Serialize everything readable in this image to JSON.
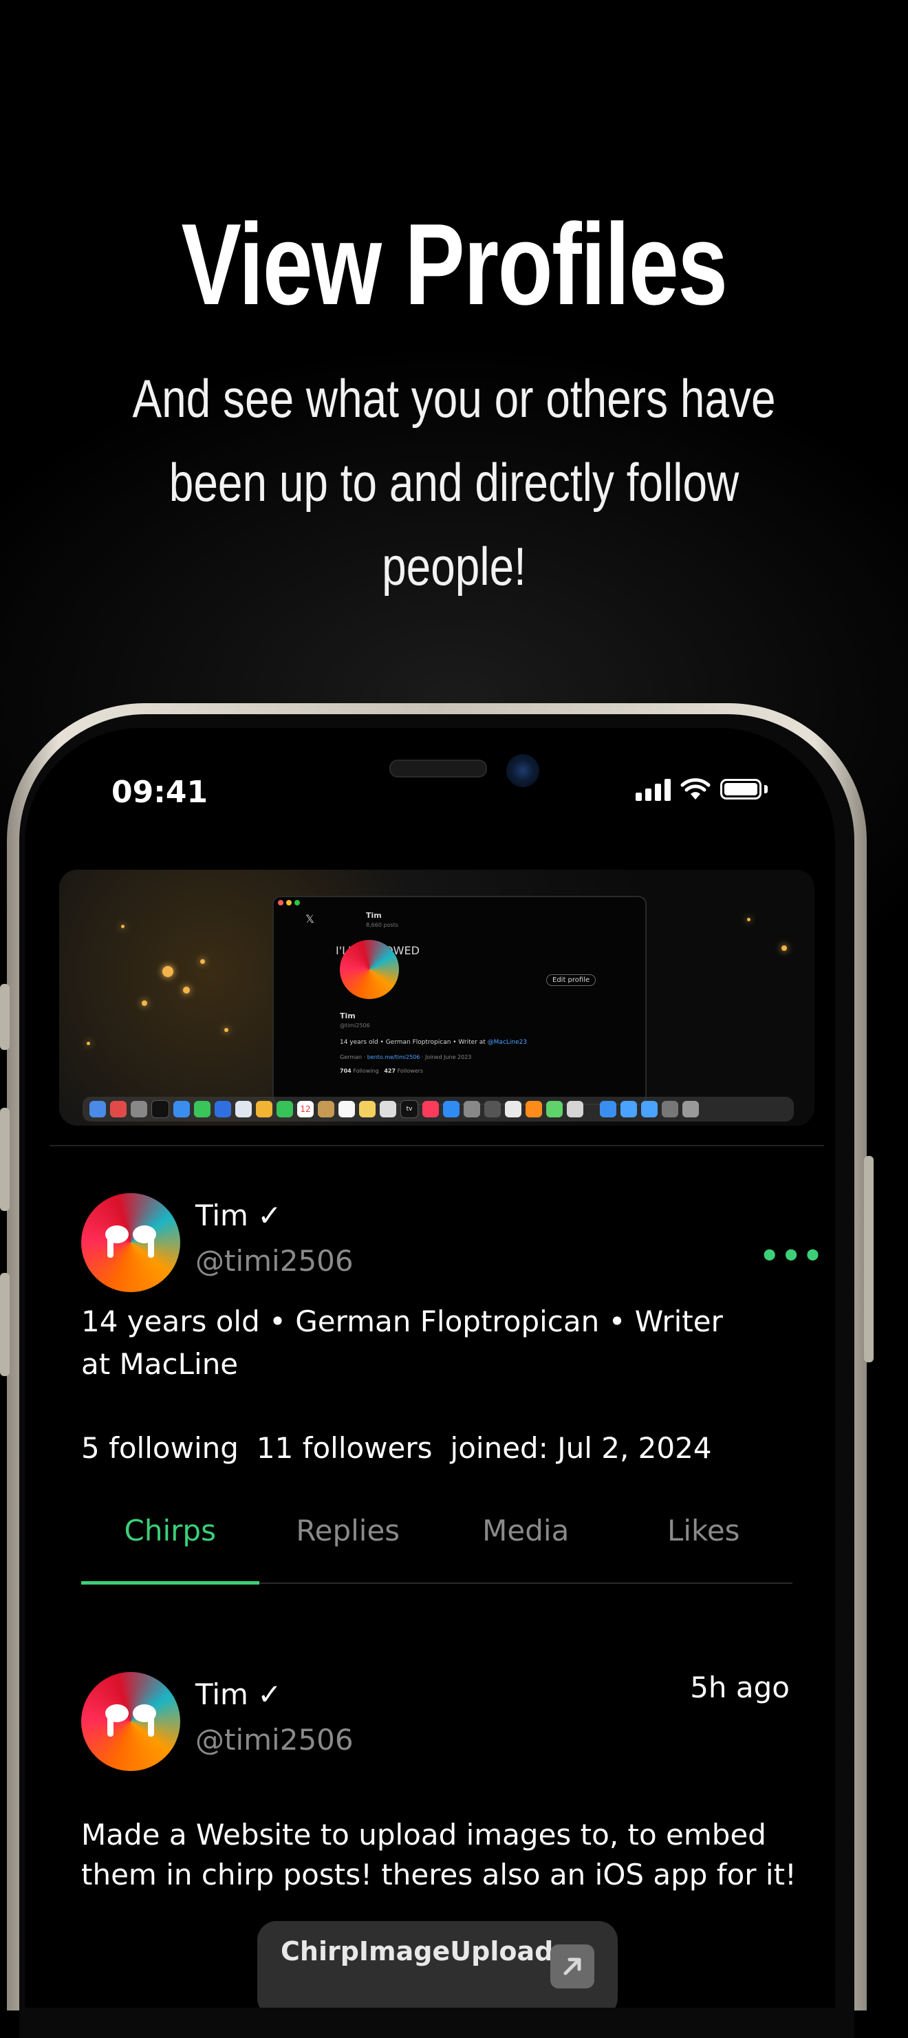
{
  "promo": {
    "title": "View Profiles",
    "subtitle": "And see what you or others have been up to and directly follow people!"
  },
  "status_bar": {
    "time": "09:41"
  },
  "banner_screenshot": {
    "window_name": "Tim",
    "window_posts": "8,660 posts",
    "overlay_text": "I'LL FOLLOWED",
    "edit_profile": "Edit profile",
    "mini_name": "Tim",
    "mini_handle": "@timi2506",
    "mini_bio_prefix": "14 years old • German Floptropican • Writer at ",
    "mini_bio_link": "@MacLine23",
    "mini_meta_location": "German",
    "mini_meta_link": "bento.me/timi2506",
    "mini_meta_joined": "Joined June 2023",
    "mini_following_count": "704",
    "mini_following_label": "Following",
    "mini_followers_count": "427",
    "mini_followers_label": "Followers",
    "dock_calendar_day": "12",
    "dock_tv_label": "tv"
  },
  "profile": {
    "name": "Tim ✓",
    "handle": "@timi2506",
    "more_label": "•••",
    "bio": "14 years old • German Floptropican • Writer at MacLine",
    "following": "5 following",
    "followers": "11 followers",
    "joined": "joined: Jul 2, 2024"
  },
  "tabs": [
    {
      "label": "Chirps",
      "active": true
    },
    {
      "label": "Replies",
      "active": false
    },
    {
      "label": "Media",
      "active": false
    },
    {
      "label": "Likes",
      "active": false
    }
  ],
  "post": {
    "name": "Tim ✓",
    "handle": "@timi2506",
    "time": "5h ago",
    "text": "Made a Website to upload images to, to embed them in chirp posts! theres also an iOS app for it!",
    "link_label": "ChirpImageUpload"
  },
  "colors": {
    "accent": "#3ccf78",
    "muted": "#8a8a8a",
    "background": "#000000"
  },
  "icons": [
    "signal-icon",
    "wifi-icon",
    "battery-icon",
    "more-icon",
    "external-link-icon",
    "verified-check-icon"
  ]
}
